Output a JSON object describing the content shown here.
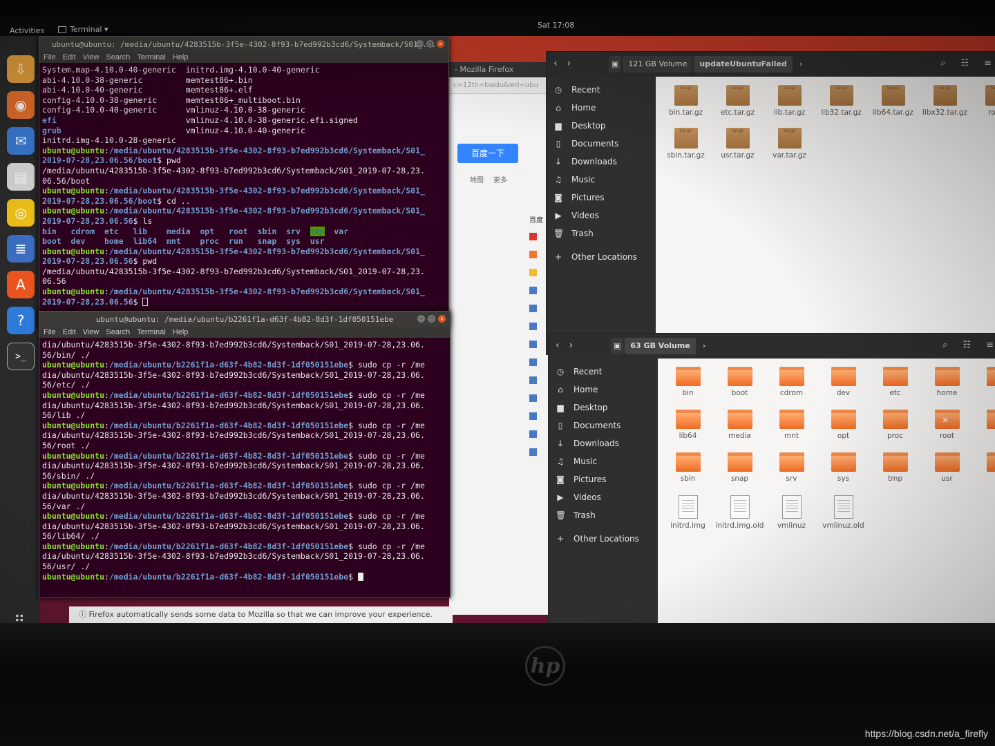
{
  "topbar": {
    "activities": "Activities",
    "app_menu": "Terminal ▾",
    "clock": "Sat 17:08"
  },
  "dock": {
    "apps_grid_icon": "apps-grid-icon",
    "items": [
      {
        "name": "ubuntu-installer-icon",
        "glyph": "⇩"
      },
      {
        "name": "firefox-icon",
        "glyph": "◉"
      },
      {
        "name": "thunderbird-icon",
        "glyph": "✉"
      },
      {
        "name": "files-icon",
        "glyph": "▤"
      },
      {
        "name": "rhythmbox-icon",
        "glyph": "◎"
      },
      {
        "name": "libreoffice-writer-icon",
        "glyph": "≣"
      },
      {
        "name": "software-center-icon",
        "glyph": "A"
      },
      {
        "name": "help-icon",
        "glyph": "?"
      },
      {
        "name": "terminal-icon",
        "glyph": ">_"
      }
    ]
  },
  "terminal1": {
    "title": "ubuntu@ubuntu: /media/ubuntu/4283515b-3f5e-4302-8f93-b7ed992b3cd6/Systemback/S01_...",
    "menu": [
      "File",
      "Edit",
      "View",
      "Search",
      "Terminal",
      "Help"
    ],
    "lines": [
      [
        [
          "System.map-4.10.0-40-generic  initrd.img-4.10.0-40-generic",
          ""
        ]
      ],
      [
        [
          "abi-4.10.0-38-generic         memtest86+.bin",
          ""
        ]
      ],
      [
        [
          "abi-4.10.0-40-generic         memtest86+.elf",
          ""
        ]
      ],
      [
        [
          "config-4.10.0-38-generic      memtest86+_multiboot.bin",
          ""
        ]
      ],
      [
        [
          "config-4.10.0-40-generic      vmlinuz-4.10.0-38-generic",
          ""
        ]
      ],
      [
        [
          "efi",
          "b"
        ],
        [
          "                           vmlinuz-4.10.0-38-generic.efi.signed",
          ""
        ]
      ],
      [
        [
          "grub",
          "b"
        ],
        [
          "                          vmlinuz-4.10.0-40-generic",
          ""
        ]
      ],
      [
        [
          "initrd.img-4.10.0-28-generic",
          ""
        ]
      ],
      [
        [
          "ubuntu@ubuntu",
          "g"
        ],
        [
          ":",
          ""
        ],
        [
          "/media/ubuntu/4283515b-3f5e-4302-8f93-b7ed992b3cd6/Systemback/S01_",
          "b"
        ]
      ],
      [
        [
          "2019-07-28,23.06.56/boot",
          "b"
        ],
        [
          "$ pwd",
          ""
        ]
      ],
      [
        [
          "/media/ubuntu/4283515b-3f5e-4302-8f93-b7ed992b3cd6/Systemback/S01_2019-07-28,23.",
          ""
        ]
      ],
      [
        [
          "06.56/boot",
          ""
        ]
      ],
      [
        [
          "ubuntu@ubuntu",
          "g"
        ],
        [
          ":",
          ""
        ],
        [
          "/media/ubuntu/4283515b-3f5e-4302-8f93-b7ed992b3cd6/Systemback/S01_",
          "b"
        ]
      ],
      [
        [
          "2019-07-28,23.06.56/boot",
          "b"
        ],
        [
          "$ cd ..",
          ""
        ]
      ],
      [
        [
          "ubuntu@ubuntu",
          "g"
        ],
        [
          ":",
          ""
        ],
        [
          "/media/ubuntu/4283515b-3f5e-4302-8f93-b7ed992b3cd6/Systemback/S01_",
          "b"
        ]
      ],
      [
        [
          "2019-07-28,23.06.56",
          "b"
        ],
        [
          "$ ls",
          ""
        ]
      ],
      [
        [
          "bin   cdrom  etc   lib    media  opt   root  sbin  srv  ",
          "b"
        ],
        [
          "tmp",
          "h"
        ],
        [
          "  var",
          "b"
        ]
      ],
      [
        [
          "boot  dev    home  lib64  mnt    proc  run   snap  sys  usr",
          "b"
        ]
      ],
      [
        [
          "ubuntu@ubuntu",
          "g"
        ],
        [
          ":",
          ""
        ],
        [
          "/media/ubuntu/4283515b-3f5e-4302-8f93-b7ed992b3cd6/Systemback/S01_",
          "b"
        ]
      ],
      [
        [
          "2019-07-28,23.06.56",
          "b"
        ],
        [
          "$ pwd",
          ""
        ]
      ],
      [
        [
          "/media/ubuntu/4283515b-3f5e-4302-8f93-b7ed992b3cd6/Systemback/S01_2019-07-28,23.",
          ""
        ]
      ],
      [
        [
          "06.56",
          ""
        ]
      ],
      [
        [
          "ubuntu@ubuntu",
          "g"
        ],
        [
          ":",
          ""
        ],
        [
          "/media/ubuntu/4283515b-3f5e-4302-8f93-b7ed992b3cd6/Systemback/S01_",
          "b"
        ]
      ],
      [
        [
          "2019-07-28,23.06.56",
          "b"
        ],
        [
          "$ ",
          ""
        ],
        [
          "",
          "c"
        ]
      ]
    ]
  },
  "terminal2": {
    "title": "ubuntu@ubuntu: /media/ubuntu/b2261f1a-d63f-4b82-8d3f-1df050151ebe",
    "menu": [
      "File",
      "Edit",
      "View",
      "Search",
      "Terminal",
      "Help"
    ],
    "lines": [
      [
        [
          "dia/ubuntu/4283515b-3f5e-4302-8f93-b7ed992b3cd6/Systemback/S01_2019-07-28,23.06.",
          ""
        ]
      ],
      [
        [
          "56/bin/ ./",
          ""
        ]
      ],
      [
        [
          "ubuntu@ubuntu",
          "g"
        ],
        [
          ":",
          ""
        ],
        [
          "/media/ubuntu/b2261f1a-d63f-4b82-8d3f-1df050151ebe",
          "b"
        ],
        [
          "$ sudo cp -r /me",
          ""
        ]
      ],
      [
        [
          "dia/ubuntu/4283515b-3f5e-4302-8f93-b7ed992b3cd6/Systemback/S01_2019-07-28,23.06.",
          ""
        ]
      ],
      [
        [
          "56/etc/ ./",
          ""
        ]
      ],
      [
        [
          "ubuntu@ubuntu",
          "g"
        ],
        [
          ":",
          ""
        ],
        [
          "/media/ubuntu/b2261f1a-d63f-4b82-8d3f-1df050151ebe",
          "b"
        ],
        [
          "$ sudo cp -r /me",
          ""
        ]
      ],
      [
        [
          "dia/ubuntu/4283515b-3f5e-4302-8f93-b7ed992b3cd6/Systemback/S01_2019-07-28,23.06.",
          ""
        ]
      ],
      [
        [
          "56/lib ./",
          ""
        ]
      ],
      [
        [
          "ubuntu@ubuntu",
          "g"
        ],
        [
          ":",
          ""
        ],
        [
          "/media/ubuntu/b2261f1a-d63f-4b82-8d3f-1df050151ebe",
          "b"
        ],
        [
          "$ sudo cp -r /me",
          ""
        ]
      ],
      [
        [
          "dia/ubuntu/4283515b-3f5e-4302-8f93-b7ed992b3cd6/Systemback/S01_2019-07-28,23.06.",
          ""
        ]
      ],
      [
        [
          "56/root ./",
          ""
        ]
      ],
      [
        [
          "ubuntu@ubuntu",
          "g"
        ],
        [
          ":",
          ""
        ],
        [
          "/media/ubuntu/b2261f1a-d63f-4b82-8d3f-1df050151ebe",
          "b"
        ],
        [
          "$ sudo cp -r /me",
          ""
        ]
      ],
      [
        [
          "dia/ubuntu/4283515b-3f5e-4302-8f93-b7ed992b3cd6/Systemback/S01_2019-07-28,23.06.",
          ""
        ]
      ],
      [
        [
          "56/sbin/ ./",
          ""
        ]
      ],
      [
        [
          "ubuntu@ubuntu",
          "g"
        ],
        [
          ":",
          ""
        ],
        [
          "/media/ubuntu/b2261f1a-d63f-4b82-8d3f-1df050151ebe",
          "b"
        ],
        [
          "$ sudo cp -r /me",
          ""
        ]
      ],
      [
        [
          "dia/ubuntu/4283515b-3f5e-4302-8f93-b7ed992b3cd6/Systemback/S01_2019-07-28,23.06.",
          ""
        ]
      ],
      [
        [
          "56/var ./",
          ""
        ]
      ],
      [
        [
          "ubuntu@ubuntu",
          "g"
        ],
        [
          ":",
          ""
        ],
        [
          "/media/ubuntu/b2261f1a-d63f-4b82-8d3f-1df050151ebe",
          "b"
        ],
        [
          "$ sudo cp -r /me",
          ""
        ]
      ],
      [
        [
          "dia/ubuntu/4283515b-3f5e-4302-8f93-b7ed992b3cd6/Systemback/S01_2019-07-28,23.06.",
          ""
        ]
      ],
      [
        [
          "56/lib64/ ./",
          ""
        ]
      ],
      [
        [
          "ubuntu@ubuntu",
          "g"
        ],
        [
          ":",
          ""
        ],
        [
          "/media/ubuntu/b2261f1a-d63f-4b82-8d3f-1df050151ebe",
          "b"
        ],
        [
          "$ sudo cp -r /me",
          ""
        ]
      ],
      [
        [
          "dia/ubuntu/4283515b-3f5e-4302-8f93-b7ed992b3cd6/Systemback/S01_2019-07-28,23.06.",
          ""
        ]
      ],
      [
        [
          "56/usr/ ./",
          ""
        ]
      ],
      [
        [
          "ubuntu@ubuntu",
          "g"
        ],
        [
          ":",
          ""
        ],
        [
          "/media/ubuntu/b2261f1a-d63f-4b82-8d3f-1df050151ebe",
          "b"
        ],
        [
          "$ ",
          ""
        ],
        [
          "",
          "cs"
        ]
      ]
    ]
  },
  "firefox": {
    "title": "- Mozilla Firefox",
    "url": "c=12th=baidu&wd=ubu",
    "search_button": "百度一下",
    "links": [
      "地图",
      "更多"
    ],
    "side_label": "百度",
    "notice": "Firefox automatically sends some data to Mozilla so that we can improve your experience."
  },
  "sidebar_items": [
    {
      "label": "Recent",
      "icon": "recent-icon",
      "glyph": "◷"
    },
    {
      "label": "Home",
      "icon": "home-icon",
      "glyph": "⌂"
    },
    {
      "label": "Desktop",
      "icon": "desktop-icon",
      "glyph": "▆"
    },
    {
      "label": "Documents",
      "icon": "documents-icon",
      "glyph": "▯"
    },
    {
      "label": "Downloads",
      "icon": "downloads-icon",
      "glyph": "↓"
    },
    {
      "label": "Music",
      "icon": "music-icon",
      "glyph": "♫"
    },
    {
      "label": "Pictures",
      "icon": "pictures-icon",
      "glyph": "◙"
    },
    {
      "label": "Videos",
      "icon": "videos-icon",
      "glyph": "▶"
    },
    {
      "label": "Trash",
      "icon": "trash-icon",
      "glyph": "🗑"
    },
    {
      "gap": true
    },
    {
      "label": "Other Locations",
      "icon": "plus-icon",
      "glyph": "+"
    }
  ],
  "files1": {
    "path": [
      "121 GB Volume",
      "updateUbuntuFailed"
    ],
    "items": [
      {
        "label": "bin.tar.gz",
        "kind": "arch"
      },
      {
        "label": "etc.tar.gz",
        "kind": "arch"
      },
      {
        "label": "lib.tar.gz",
        "kind": "arch"
      },
      {
        "label": "lib32.tar.gz",
        "kind": "arch"
      },
      {
        "label": "lib64.tar.gz",
        "kind": "arch"
      },
      {
        "label": "libx32.tar.gz",
        "kind": "arch"
      },
      {
        "label": "root.",
        "kind": "arch"
      },
      {
        "label": "sbin.tar.gz",
        "kind": "arch"
      },
      {
        "label": "usr.tar.gz",
        "kind": "arch"
      },
      {
        "label": "var.tar.gz",
        "kind": "arch"
      }
    ],
    "archive_badge": "tar.gz"
  },
  "files2": {
    "path": [
      "63 GB Volume"
    ],
    "items": [
      {
        "label": "bin",
        "kind": "folder"
      },
      {
        "label": "boot",
        "kind": "folder"
      },
      {
        "label": "cdrom",
        "kind": "folder"
      },
      {
        "label": "dev",
        "kind": "folder"
      },
      {
        "label": "etc",
        "kind": "folder"
      },
      {
        "label": "home",
        "kind": "folder"
      },
      {
        "label": "",
        "kind": "folder"
      },
      {
        "label": "lib64",
        "kind": "folder"
      },
      {
        "label": "media",
        "kind": "folder"
      },
      {
        "label": "mnt",
        "kind": "folder"
      },
      {
        "label": "opt",
        "kind": "folder"
      },
      {
        "label": "proc",
        "kind": "folder"
      },
      {
        "label": "root",
        "kind": "folder-x"
      },
      {
        "label": "",
        "kind": "folder"
      },
      {
        "label": "sbin",
        "kind": "folder"
      },
      {
        "label": "snap",
        "kind": "folder"
      },
      {
        "label": "srv",
        "kind": "folder"
      },
      {
        "label": "sys",
        "kind": "folder"
      },
      {
        "label": "tmp",
        "kind": "folder"
      },
      {
        "label": "usr",
        "kind": "folder"
      },
      {
        "label": "",
        "kind": "folder"
      },
      {
        "label": "initrd.img",
        "kind": "doc"
      },
      {
        "label": "initrd.img.old",
        "kind": "doc"
      },
      {
        "label": "vmlinuz",
        "kind": "doc"
      },
      {
        "label": "vmlinuz.old",
        "kind": "doc"
      }
    ]
  },
  "bezel": {
    "logo": "hp"
  },
  "watermark": "https://blog.csdn.net/a_firefly",
  "colors": {
    "terminal_bg": "#2c001e",
    "prompt_green": "#8ae234",
    "path_blue": "#729fcf",
    "ubuntu_orange": "#e95420"
  }
}
